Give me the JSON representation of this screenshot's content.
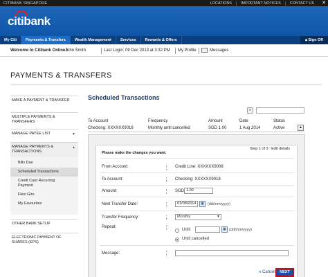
{
  "topbar": {
    "brand": "CITIBANK SINGAPORE",
    "links": [
      "LOCATIONS",
      "IMPORTANT NOTICES",
      "CONTACT US"
    ],
    "close": "✕"
  },
  "logo": {
    "text": "citibank"
  },
  "nav": {
    "items": [
      "My Citi",
      "Payments & Transfers",
      "Wealth Management",
      "Services",
      "Rewards & Offers"
    ],
    "sign_off": "Sign Off"
  },
  "welcome": {
    "greeting": "Welcome to Citibank Online !",
    "user": "John Smith",
    "last_login": "Last Login: 09 Dec 2013 at 3:32 PM",
    "profile": "My Profile",
    "messages": "Messages"
  },
  "page_title": "PAYMENTS & TRANSFERS",
  "sidebar": {
    "make_payment": "MAKE A PAYMENT & TRANSFER",
    "multiple": "MULTIPLE PAYMENTS & TRANSFERS",
    "payee_list": "MANAGE PAYEE LIST",
    "manage": "MANAGE PAYMENTS & TRANSACTIONS",
    "subitems": [
      "Bills Due",
      "Scheduled Transactions",
      "Credit Card Recurring Payment",
      "Flexi Giro",
      "My Favourites"
    ],
    "other_bank": "OTHER BANK SETUP",
    "eps": "ELECTRONIC PAYMENT OF SHARES (EPS)"
  },
  "content": {
    "title": "Scheduled Transactions",
    "columns": [
      "To Account",
      "Frequency",
      "Amount",
      "Date",
      "Status"
    ],
    "row": [
      "Checking: XXXXXX9018",
      "Monthly until cancelled",
      "SGD 1.00",
      "1 Aug 2014",
      "Active"
    ]
  },
  "form": {
    "instruction": "Please make the changes you want.",
    "step": "Step 1 of 3 : Edit details",
    "from_label": "From Account:",
    "from_value": "Credit Line: XXXXXX9008",
    "to_label": "To Account:",
    "to_value": "Checking: XXXXXX9018",
    "amount_label": "Amount:",
    "currency": "SGD",
    "amount_value": "1.00",
    "next_date_label": "Next Transfer Date:",
    "next_date_value": "01/08/2014",
    "date_hint": "(dd/mm/yyyy)",
    "frequency_label": "Transfer Frequency:",
    "frequency_value": "Monthly",
    "repeat_label": "Repeat:",
    "until_label": "Until",
    "until_cancelled_label": "Until cancelled",
    "message_label": "Message:",
    "cancel": "Cancel",
    "next": "NEXT"
  }
}
